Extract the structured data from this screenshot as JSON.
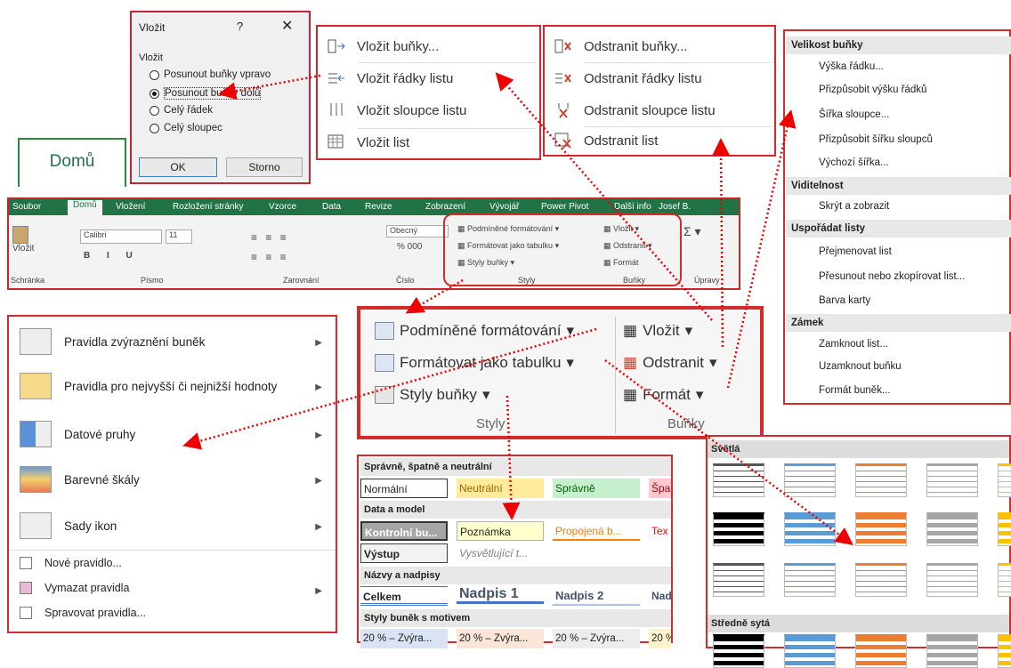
{
  "dialog": {
    "title": "Vložit",
    "help": "?",
    "close": "✕",
    "group": "Vložit",
    "options": [
      "Posunout buňky vpravo",
      "Posunout buňky dolů",
      "Celý řádek",
      "Celý sloupec"
    ],
    "ok": "OK",
    "cancel": "Storno"
  },
  "home_tab": "Domů",
  "insert_menu": [
    "Vložit buňky...",
    "Vložit řádky listu",
    "Vložit sloupce listu",
    "Vložit list"
  ],
  "delete_menu": [
    "Odstranit buňky...",
    "Odstranit řádky listu",
    "Odstranit sloupce listu",
    "Odstranit list"
  ],
  "ribbon": {
    "tabs": [
      "Soubor",
      "Domů",
      "Vložení",
      "Rozložení stránky",
      "Vzorce",
      "Data",
      "Revize",
      "Zobrazení",
      "Vývojář",
      "Power Pivot",
      "Další info",
      "Josef B."
    ],
    "font": "Calibri",
    "size": "11",
    "number_format": "Obecný",
    "styles": [
      "Podmíněné formátování",
      "Formátovat jako tabulku",
      "Styly buňky"
    ],
    "cells": [
      "Vložit",
      "Odstranit",
      "Formát"
    ],
    "groups": [
      "Schránka",
      "Písmo",
      "Zarovnání",
      "Číslo",
      "Styly",
      "Buňky",
      "Úpravy"
    ],
    "paste": "Vložit"
  },
  "zoom": {
    "styles": [
      "Podmíněné formátování",
      "Formátovat jako tabulku",
      "Styly buňky"
    ],
    "cells": [
      "Vložit",
      "Odstranit",
      "Formát"
    ],
    "group_styles": "Styly",
    "group_cells": "Buňky"
  },
  "cf_menu": {
    "items": [
      "Pravidla zvýraznění buněk",
      "Pravidla pro nejvyšší či nejnižší hodnoty",
      "Datové pruhy",
      "Barevné škály",
      "Sady ikon"
    ],
    "small": [
      "Nové pravidlo...",
      "Vymazat pravidla",
      "Spravovat pravidla..."
    ]
  },
  "format_menu": {
    "h1": "Velikost buňky",
    "a": [
      "Výška řádku...",
      "Přizpůsobit výšku řádků",
      "Šířka sloupce...",
      "Přizpůsobit šířku sloupců",
      "Výchozí šířka..."
    ],
    "h2": "Viditelnost",
    "b": [
      "Skrýt a zobrazit"
    ],
    "h3": "Uspořádat listy",
    "c": [
      "Přejmenovat list",
      "Přesunout nebo zkopírovat list...",
      "Barva karty"
    ],
    "h4": "Zámek",
    "d": [
      "Zamknout list...",
      "Uzamknout buňku",
      "Formát buněk..."
    ]
  },
  "cell_styles": {
    "h1": "Správně, špatně a neutrální",
    "r1": [
      "Normální",
      "Neutrální",
      "Správně",
      "Špa"
    ],
    "h2": "Data a model",
    "r2": [
      "Kontrolní bu...",
      "Poznámka",
      "Propojená b...",
      "Tex"
    ],
    "r3": [
      "Výstup",
      "Vysvětlující t..."
    ],
    "h3": "Názvy a nadpisy",
    "r4": [
      "Celkem",
      "Nadpis 1",
      "Nadpis 2",
      "Nad"
    ],
    "h4": "Styly buněk s motivem",
    "r5": [
      "20 % – Zvýra...",
      "20 % – Zvýra...",
      "20 % – Zvýra...",
      "20 %"
    ]
  },
  "table_styles": {
    "h1": "Světlá",
    "h2": "Středně sytá"
  }
}
